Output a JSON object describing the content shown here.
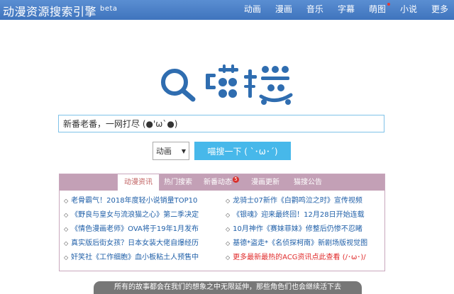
{
  "header": {
    "title": "动漫资源搜索引擎",
    "beta": "beta",
    "nav": [
      {
        "label": "动画"
      },
      {
        "label": "漫画"
      },
      {
        "label": "音乐"
      },
      {
        "label": "字幕"
      },
      {
        "label": "萌图"
      },
      {
        "label": "小说"
      },
      {
        "label": "更多"
      }
    ]
  },
  "search": {
    "value": "新番老番，一网打尽 (●'ω`●)",
    "type": "动画",
    "button": "喵搜一下 ( `･ω･´)"
  },
  "news": {
    "tabs": [
      {
        "label": "动漫资讯"
      },
      {
        "label": "热门搜索"
      },
      {
        "label": "新番动态"
      },
      {
        "label": "漫画更新"
      },
      {
        "label": "猫搜公告"
      }
    ],
    "badge": "5",
    "left": [
      "老骨霸气！2018年度轻小说销量TOP10",
      "《野良与皇女与流浪猫之心》第二季决定",
      "《情色漫画老师》OVA将于19年1月发布",
      "真实版后街女孩？日本女装大佬自爆经历",
      "奸笑社《工作细胞》血小板粘土人预售中"
    ],
    "right": [
      "龙骑士07新作《白鹳鸣泣之时》宣传视频",
      "《银魂》迎来最终回！12月28日开始连载",
      "10月神作《赛妹菲妹》修整后仍惨不忍睹",
      "基德*盗走*《名侦探柯南》新剧场版视觉图",
      "更多最新最热的ACG资讯点此查看 (/･ω･)/"
    ]
  },
  "footer": {
    "text": "所有的故事都会在我们的想象之中无限延伸，那些角色们也会继续活下去"
  }
}
